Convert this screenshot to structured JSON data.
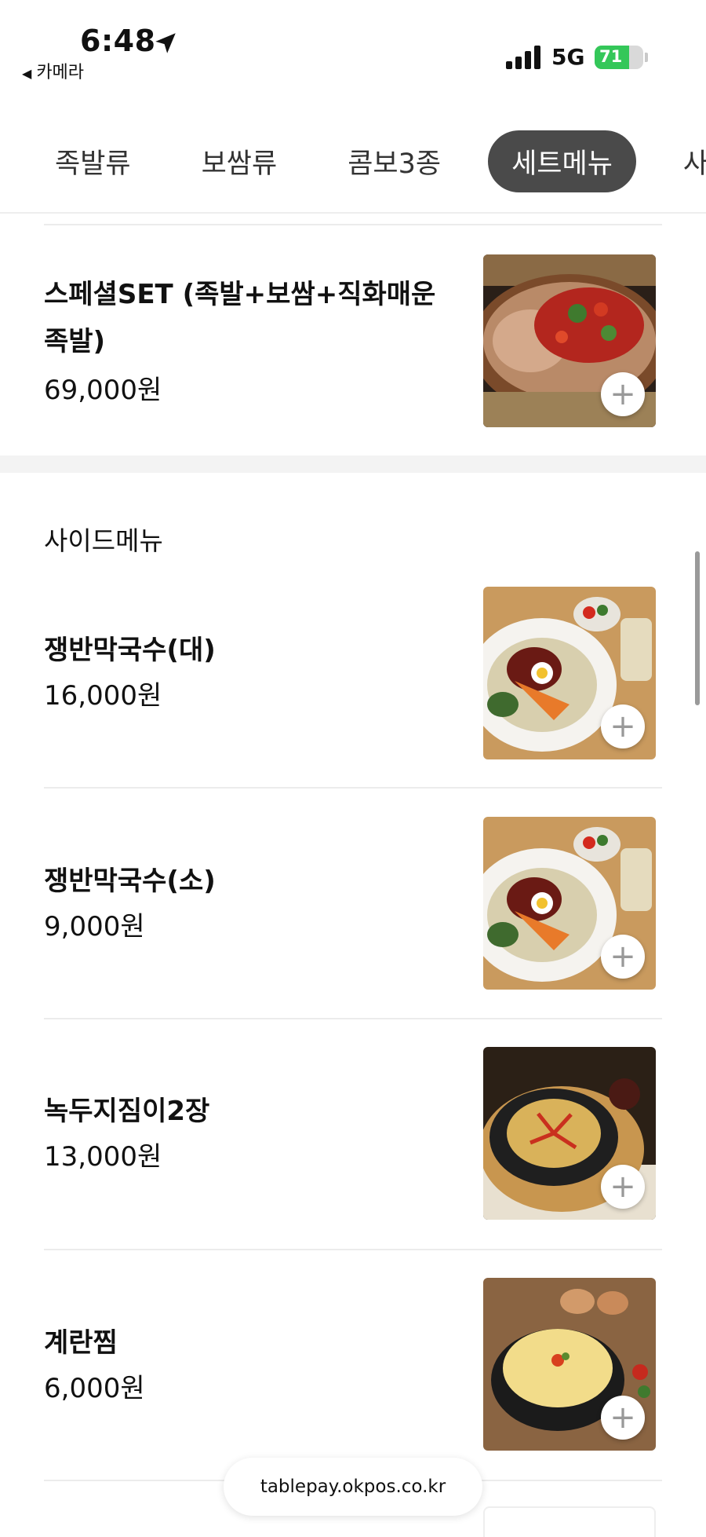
{
  "status_bar": {
    "time": "6:48",
    "back_app": "카메라",
    "network": "5G",
    "battery": "71",
    "battery_level": 0.71
  },
  "tabs": [
    {
      "label": "족발류",
      "active": false
    },
    {
      "label": "보쌈류",
      "active": false
    },
    {
      "label": "콤보3종",
      "active": false
    },
    {
      "label": "세트메뉴",
      "active": true
    },
    {
      "label": "사이드메뉴",
      "active": false
    }
  ],
  "set_menu": {
    "items": [
      {
        "name": "스페셜SET (족발+보쌈+직화매운족발)",
        "price": "69,000원",
        "image": "special-set-food-photo"
      }
    ]
  },
  "side_menu": {
    "title": "사이드메뉴",
    "items": [
      {
        "name": "쟁반막국수(대)",
        "price": "16,000원",
        "image": "buckwheat-noodle-platter-photo"
      },
      {
        "name": "쟁반막국수(소)",
        "price": "9,000원",
        "image": "buckwheat-noodle-platter-photo"
      },
      {
        "name": "녹두지짐이2장",
        "price": "13,000원",
        "image": "mung-bean-pancake-photo"
      },
      {
        "name": "계란찜",
        "price": "6,000원",
        "image": "steamed-egg-photo"
      }
    ]
  },
  "add_button_label": "+",
  "url_bar": {
    "host": "tablepay.okpos.co.kr"
  }
}
